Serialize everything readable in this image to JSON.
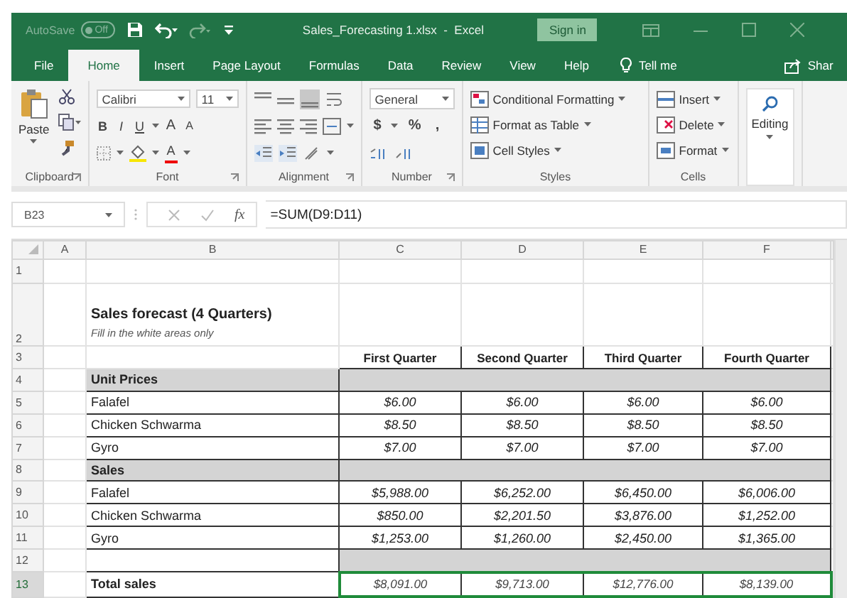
{
  "title_bar": {
    "autosave": {
      "label": "AutoSave",
      "state": "Off",
      "on": false
    },
    "title": "Sales_Forecasting 1.xlsx  -  Excel",
    "sign_in": "Sign in"
  },
  "tabs": [
    {
      "label": "File",
      "selected": false
    },
    {
      "label": "Home",
      "selected": true
    },
    {
      "label": "Insert",
      "selected": false
    },
    {
      "label": "Page Layout",
      "selected": false
    },
    {
      "label": "Formulas",
      "selected": false
    },
    {
      "label": "Data",
      "selected": false
    },
    {
      "label": "Review",
      "selected": false
    },
    {
      "label": "View",
      "selected": false
    },
    {
      "label": "Help",
      "selected": false
    }
  ],
  "tell_me": "Tell me",
  "share": "Shar",
  "ribbon": {
    "groups": [
      {
        "kind": "clipboard",
        "label": "Clipboard",
        "paste": "Paste"
      },
      {
        "kind": "font",
        "label": "Font",
        "font_name": "Calibri",
        "font_size": "11",
        "bold": "B",
        "italic": "I",
        "underline": "U",
        "grow": "A",
        "shrink": "A",
        "font_color": "A"
      },
      {
        "kind": "alignment",
        "label": "Alignment"
      },
      {
        "kind": "number",
        "label": "Number",
        "format": "General",
        "currency": "$",
        "percent": "%",
        "comma": ","
      },
      {
        "kind": "styles",
        "label": "Styles",
        "items": [
          "Conditional Formatting",
          "Format as Table",
          "Cell Styles"
        ]
      },
      {
        "kind": "cells",
        "label": "Cells",
        "items": [
          "Insert",
          "Delete",
          "Format"
        ]
      },
      {
        "kind": "editing",
        "label": "Editing"
      }
    ]
  },
  "formula_bar": {
    "name_box": "B23",
    "fx": "fx",
    "formula": "=SUM(D9:D11)"
  },
  "sheet": {
    "columns": [
      "A",
      "B",
      "C",
      "D",
      "E",
      "F"
    ],
    "rows": [
      {
        "number": "1",
        "kind": "blank",
        "selected": false
      },
      {
        "number": "2",
        "kind": "title",
        "title": "Sales forecast (4 Quarters)",
        "subtitle": "Fill in the white areas only",
        "selected": false
      },
      {
        "number": "3",
        "kind": "header",
        "values": [
          "First Quarter",
          "Second Quarter",
          "Third Quarter",
          "Fourth Quarter"
        ],
        "selected": false
      },
      {
        "number": "4",
        "kind": "section",
        "label": "Unit Prices",
        "selected": false
      },
      {
        "number": "5",
        "kind": "item",
        "label": "Falafel",
        "values": [
          "$6.00",
          "$6.00",
          "$6.00",
          "$6.00"
        ],
        "selected": false
      },
      {
        "number": "6",
        "kind": "item",
        "label": "Chicken Schwarma",
        "values": [
          "$8.50",
          "$8.50",
          "$8.50",
          "$8.50"
        ],
        "selected": false
      },
      {
        "number": "7",
        "kind": "item",
        "label": "Gyro",
        "values": [
          "$7.00",
          "$7.00",
          "$7.00",
          "$7.00"
        ],
        "selected": false
      },
      {
        "number": "8",
        "kind": "section",
        "label": "Sales",
        "selected": false
      },
      {
        "number": "9",
        "kind": "item",
        "label": "Falafel",
        "values": [
          "$5,988.00",
          "$6,252.00",
          "$6,450.00",
          "$6,006.00"
        ],
        "selected": false
      },
      {
        "number": "10",
        "kind": "item",
        "label": "Chicken Schwarma",
        "values": [
          "$850.00",
          "$2,201.50",
          "$3,876.00",
          "$1,252.00"
        ],
        "selected": false
      },
      {
        "number": "11",
        "kind": "item",
        "label": "Gyro",
        "values": [
          "$1,253.00",
          "$1,260.00",
          "$2,450.00",
          "$1,365.00"
        ],
        "selected": false
      },
      {
        "number": "12",
        "kind": "spacer",
        "selected": false
      },
      {
        "number": "13",
        "kind": "total",
        "label": "Total sales",
        "values": [
          "$8,091.00",
          "$9,713.00",
          "$12,776.00",
          "$8,139.00"
        ],
        "selected": true
      }
    ]
  }
}
